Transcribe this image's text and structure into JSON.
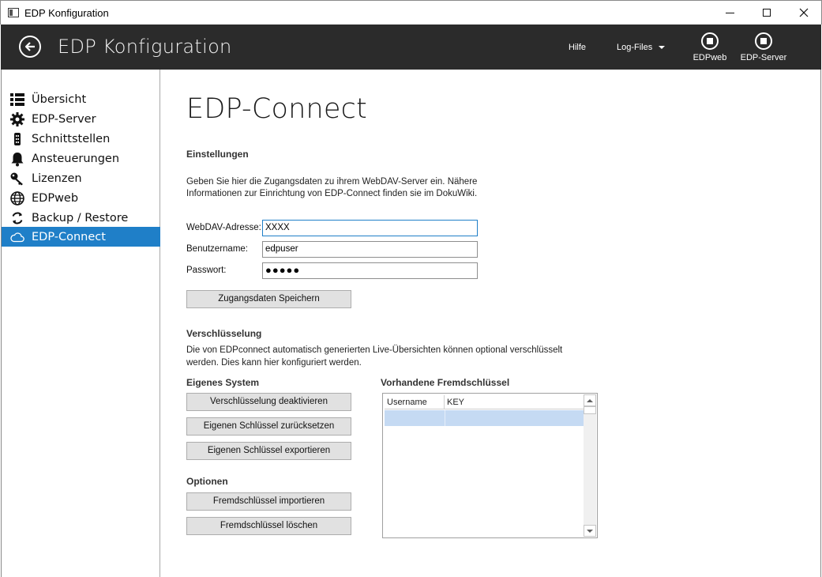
{
  "window": {
    "title": "EDP Konfiguration",
    "minimize_label": "—",
    "maximize_label": "☐",
    "close_label": "✕"
  },
  "header": {
    "title": "EDP Konfiguration",
    "help_label": "Hilfe",
    "logfiles_label": "Log-Files",
    "tools": [
      {
        "label": "EDPweb",
        "icon": "stop-circle-icon"
      },
      {
        "label": "EDP-Server",
        "icon": "stop-circle-icon"
      }
    ]
  },
  "sidebar": {
    "items": [
      {
        "label": "Übersicht",
        "icon": "list-icon"
      },
      {
        "label": "EDP-Server",
        "icon": "gear-icon"
      },
      {
        "label": "Schnittstellen",
        "icon": "plug-icon"
      },
      {
        "label": "Ansteuerungen",
        "icon": "bell-icon"
      },
      {
        "label": "Lizenzen",
        "icon": "key-icon"
      },
      {
        "label": "EDPweb",
        "icon": "globe-icon"
      },
      {
        "label": "Backup / Restore",
        "icon": "sync-icon"
      },
      {
        "label": "EDP-Connect",
        "icon": "cloud-icon",
        "active": true
      }
    ],
    "accent_color": "#1f7fc8"
  },
  "main": {
    "page_title": "EDP-Connect",
    "settings": {
      "heading": "Einstellungen",
      "description_line1": "Geben Sie hier die Zugangsdaten zu ihrem WebDAV-Server ein. Nähere",
      "description_line2": "Informationen zur Einrichtung von EDP-Connect finden sie im DokuWiki.",
      "webdav_label": "WebDAV-Adresse:",
      "webdav_value": "XXXX",
      "username_label": "Benutzername:",
      "username_value": "edpuser",
      "password_label": "Passwort:",
      "password_value": "●●●●●",
      "save_button": "Zugangsdaten Speichern"
    },
    "encryption": {
      "heading": "Verschlüsselung",
      "description_line1": "Die von EDPconnect automatisch generierten Live-Übersichten können optional verschlüsselt",
      "description_line2": "werden. Dies kann hier konfiguriert werden.",
      "own_system_heading": "Eigenes System",
      "disable_button": "Verschlüsselung deaktivieren",
      "reset_button": "Eigenen Schlüssel zurücksetzen",
      "export_button": "Eigenen Schlüssel exportieren",
      "options_heading": "Optionen",
      "import_button": "Fremdschlüssel importieren",
      "delete_button": "Fremdschlüssel löschen",
      "foreign_keys_heading": "Vorhandene Fremdschlüssel",
      "table": {
        "columns": [
          "Username",
          "KEY"
        ],
        "rows": [
          [
            "",
            ""
          ]
        ]
      }
    }
  }
}
